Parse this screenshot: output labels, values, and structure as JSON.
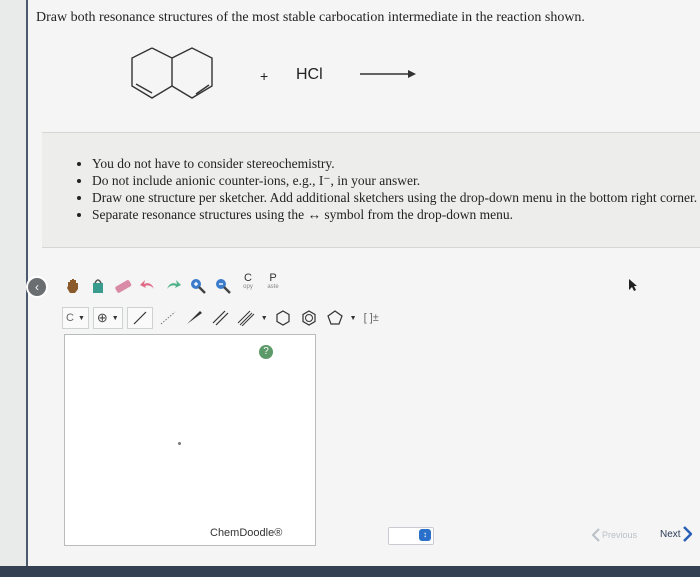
{
  "question": {
    "text": "Draw both resonance structures of the most stable carbocation intermediate in the reaction shown."
  },
  "reaction": {
    "plus": "+",
    "reagent": "HCl"
  },
  "instructions": [
    "You do not have to consider stereochemistry.",
    "Do not include anionic counter-ions, e.g., I⁻, in your answer.",
    "Draw one structure per sketcher. Add additional sketchers using the drop-down menu in the bottom right corner.",
    "Separate resonance structures using the ↔ symbol from the drop-down menu."
  ],
  "toolbar": {
    "copy_top": "C",
    "copy_bottom": "opy",
    "paste_top": "P",
    "paste_bottom": "aste",
    "element": "C",
    "charge": "⊕",
    "brackets": "[ ]±"
  },
  "sketcher": {
    "help": "?",
    "brand": "ChemDoodle®"
  },
  "navigation": {
    "previous": "Previous",
    "next": "Next"
  },
  "colors": {
    "accent": "#2a6fc9",
    "sidebar": "#4c5a70",
    "help": "#5c9a6a"
  }
}
